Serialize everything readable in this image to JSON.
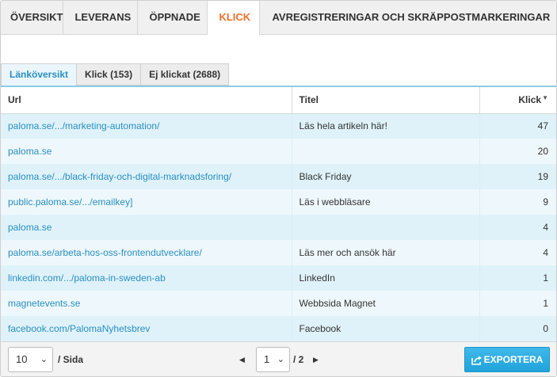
{
  "main_tabs": [
    {
      "label": "Översikt"
    },
    {
      "label": "Leverans"
    },
    {
      "label": "Öppnade"
    },
    {
      "label": "Klick"
    },
    {
      "label": "Avregistreringar och skräppostmarkeringar"
    }
  ],
  "active_main_tab": "Klick",
  "sub_tabs": [
    {
      "label": "Länköversikt"
    },
    {
      "label": "Klick (153)"
    },
    {
      "label": "Ej klickat (2688)"
    }
  ],
  "table": {
    "headers": {
      "url": "Url",
      "title": "Titel",
      "clicks": "Klick"
    },
    "sort_column": "Klick",
    "sort_direction": "descending",
    "rows": [
      {
        "url": "paloma.se/.../marketing-automation/",
        "title": "Läs hela artikeln här!",
        "clicks": "47"
      },
      {
        "url": "paloma.se",
        "title": "",
        "clicks": "20"
      },
      {
        "url": "paloma.se/.../black-friday-och-digital-marknadsforing/",
        "title": "Black Friday",
        "clicks": "19"
      },
      {
        "url": "public.paloma.se/.../emailkey]",
        "title": "Läs i webbläsare",
        "clicks": "9"
      },
      {
        "url": "paloma.se",
        "title": "",
        "clicks": "4"
      },
      {
        "url": "paloma.se/arbeta-hos-oss-frontendutvecklare/",
        "title": "Läs mer och ansök här",
        "clicks": "4"
      },
      {
        "url": "linkedin.com/.../paloma-in-sweden-ab",
        "title": "LinkedIn",
        "clicks": "1"
      },
      {
        "url": "magnetevents.se",
        "title": "Webbsida Magnet",
        "clicks": "1"
      },
      {
        "url": "facebook.com/PalomaNyhetsbrev",
        "title": "Facebook",
        "clicks": "0"
      }
    ]
  },
  "footer": {
    "per_page_value": "10",
    "per_page_label": "/ Sida",
    "current_page": "1",
    "total_pages_label": "/ 2",
    "prev_arrow": "◀",
    "next_arrow": "▶",
    "export_label": "Exportera"
  },
  "colors": {
    "accent_orange": "#e8702a",
    "link_blue": "#2a8fc0",
    "export_button": "#2aaee2"
  }
}
